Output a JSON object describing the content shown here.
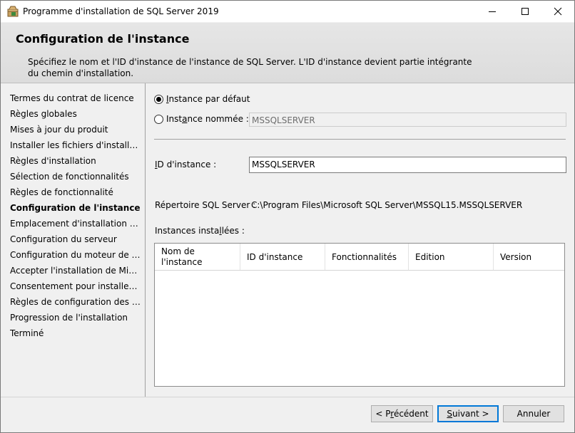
{
  "window": {
    "title": "Programme d'installation de SQL Server 2019"
  },
  "header": {
    "title": "Configuration de l'instance",
    "description": "Spécifiez le nom et l'ID d'instance de l'instance de SQL Server. L'ID d'instance devient partie intégrante du chemin d'installation."
  },
  "sidebar": {
    "items": [
      {
        "label": "Termes du contrat de licence",
        "active": false
      },
      {
        "label": "Règles globales",
        "active": false
      },
      {
        "label": "Mises à jour du produit",
        "active": false
      },
      {
        "label": "Installer les fichiers d'installation",
        "active": false
      },
      {
        "label": "Règles d'installation",
        "active": false
      },
      {
        "label": "Sélection de fonctionnalités",
        "active": false
      },
      {
        "label": "Règles de fonctionnalité",
        "active": false
      },
      {
        "label": "Configuration de l'instance",
        "active": true
      },
      {
        "label": "Emplacement d'installation de ...",
        "active": false
      },
      {
        "label": "Configuration du serveur",
        "active": false
      },
      {
        "label": "Configuration du moteur de ba...",
        "active": false
      },
      {
        "label": "Accepter l'installation de Micro...",
        "active": false
      },
      {
        "label": "Consentement pour installer Py...",
        "active": false
      },
      {
        "label": "Règles de configuration des fo...",
        "active": false
      },
      {
        "label": "Progression de l'installation",
        "active": false
      },
      {
        "label": "Terminé",
        "active": false
      }
    ]
  },
  "instance": {
    "default_radio_label_key": "I",
    "default_radio_label_rest": "nstance par défaut",
    "default_selected": true,
    "named_radio_label_pre": "Inst",
    "named_radio_label_key": "a",
    "named_radio_label_rest": "nce nommée :",
    "named_value": "MSSQLSERVER",
    "id_label_key": "I",
    "id_label_rest": "D d'instance :",
    "id_value": "MSSQLSERVER",
    "dir_label": "Répertoire SQL Server :",
    "dir_value": "C:\\Program Files\\Microsoft SQL Server\\MSSQL15.MSSQLSERVER",
    "installed_label_pre": "Instances insta",
    "installed_label_key": "l",
    "installed_label_rest": "lées :"
  },
  "grid": {
    "col_name_line1": "Nom de",
    "col_name_line2": "l'instance",
    "col_id": "ID d'instance",
    "col_features": "Fonctionnalités",
    "col_edition": "Edition",
    "col_version": "Version"
  },
  "buttons": {
    "prev_pre": "< P",
    "prev_key": "r",
    "prev_rest": "écédent",
    "next_key": "S",
    "next_rest": "uivant >",
    "cancel": "Annuler"
  }
}
